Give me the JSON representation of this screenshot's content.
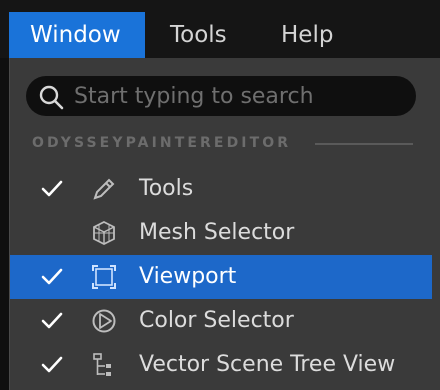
{
  "menubar": {
    "items": [
      {
        "label": "Window",
        "active": true
      },
      {
        "label": "Tools"
      },
      {
        "label": "Help"
      }
    ]
  },
  "search": {
    "placeholder": "Start typing to search",
    "icon": "search-icon"
  },
  "section": {
    "header": "ODYSSEYPAINTEREDITOR"
  },
  "menu_items": [
    {
      "label": "Tools",
      "checked": true,
      "icon": "pencil-icon"
    },
    {
      "label": "Mesh Selector",
      "checked": false,
      "icon": "mesh-icon"
    },
    {
      "label": "Viewport",
      "checked": true,
      "icon": "viewport-icon",
      "selected": true
    },
    {
      "label": "Color Selector",
      "checked": true,
      "icon": "color-wheel-icon"
    },
    {
      "label": "Vector Scene Tree View",
      "checked": true,
      "icon": "tree-view-icon"
    }
  ],
  "colors": {
    "accent": "#1a73d9",
    "selected_row": "#1d68c9",
    "menu_bg": "#3a3a3a",
    "menubar_bg": "#151515"
  }
}
